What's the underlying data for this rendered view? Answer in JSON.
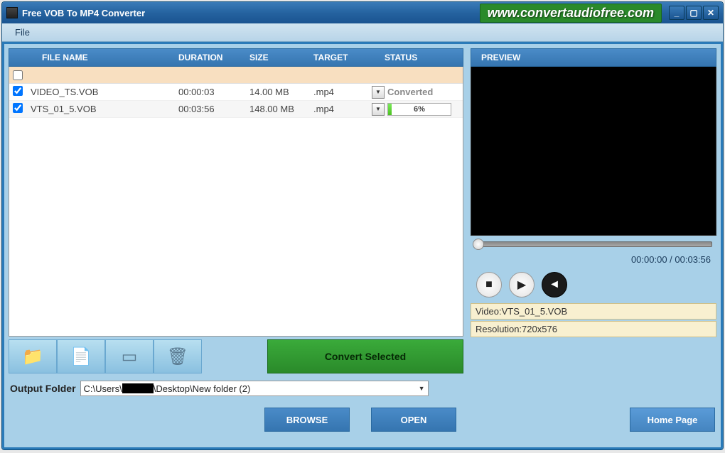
{
  "window": {
    "title": "Free VOB To MP4 Converter",
    "url": "www.convertaudiofree.com"
  },
  "menubar": {
    "file": "File"
  },
  "table": {
    "headers": {
      "name": "FILE NAME",
      "duration": "DURATION",
      "size": "SIZE",
      "target": "TARGET",
      "status": "STATUS"
    },
    "rows": [
      {
        "checked": true,
        "name": "VIDEO_TS.VOB",
        "duration": "00:00:03",
        "size": "14.00 MB",
        "target": ".mp4",
        "status_type": "done",
        "status_text": "Converted"
      },
      {
        "checked": true,
        "name": "VTS_01_5.VOB",
        "duration": "00:03:56",
        "size": "148.00 MB",
        "target": ".mp4",
        "status_type": "progress",
        "progress_pct": 6,
        "progress_text": "6%"
      }
    ]
  },
  "toolbar": {
    "convert": "Convert Selected"
  },
  "preview": {
    "header": "PREVIEW",
    "time": "00:00:00  /  00:03:56",
    "video_label": "Video:",
    "video_value": "VTS_01_5.VOB",
    "res_label": "Resolution:",
    "res_value": "720x576"
  },
  "output": {
    "label": "Output Folder",
    "path_pre": "C:\\Users\\",
    "path_post": "\\Desktop\\New folder (2)"
  },
  "buttons": {
    "browse": "BROWSE",
    "open": "OPEN",
    "home": "Home Page"
  }
}
